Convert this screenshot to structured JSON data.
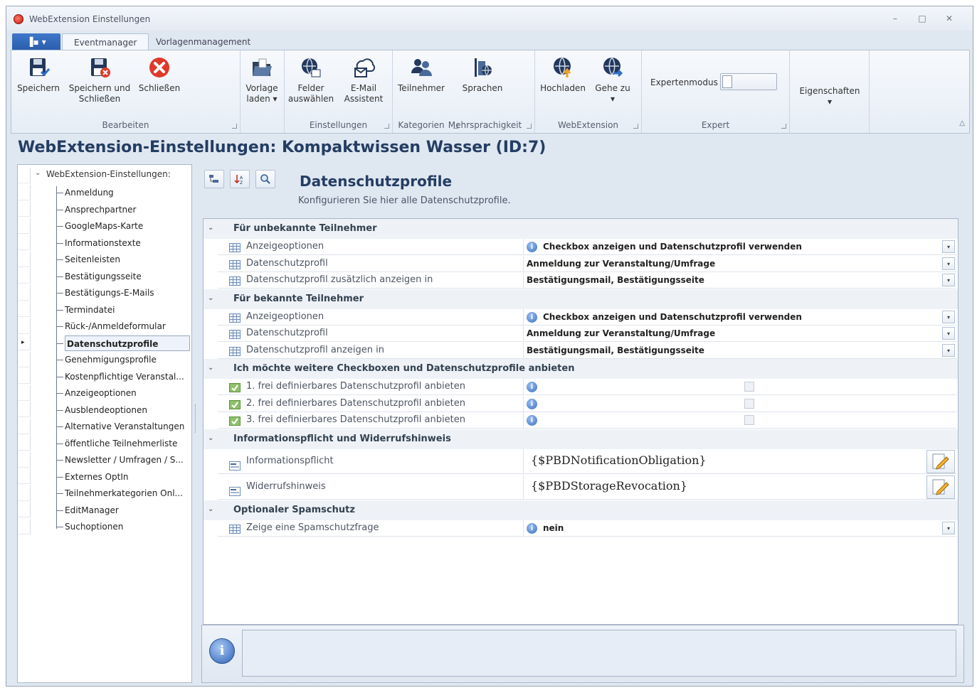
{
  "window": {
    "title": "WebExtension Einstellungen",
    "controls": [
      "–",
      "□",
      "✕"
    ]
  },
  "ribbon_tabs": {
    "menu_label": "▐▪ ▾",
    "tabs": [
      "Eventmanager",
      "Vorlagenmanagement"
    ]
  },
  "ribbon": {
    "groups": [
      {
        "label": "Bearbeiten",
        "buttons": [
          {
            "l1": "Speichern",
            "l2": ""
          },
          {
            "l1": "Speichern und",
            "l2": "Schließen"
          },
          {
            "l1": "Schließen",
            "l2": ""
          }
        ]
      },
      {
        "label": "",
        "buttons": [
          {
            "l1": "Vorlage",
            "l2": "laden ▾"
          }
        ]
      },
      {
        "label": "Einstellungen",
        "buttons": [
          {
            "l1": "Felder",
            "l2": "auswählen"
          },
          {
            "l1": "E-Mail",
            "l2": "Assistent"
          }
        ]
      },
      {
        "label": "Kategorien",
        "buttons": [
          {
            "l1": "Teilnehmer",
            "l2": ""
          }
        ]
      },
      {
        "label": "Mehrsprachigkeit",
        "buttons": [
          {
            "l1": "Sprachen",
            "l2": ""
          }
        ]
      },
      {
        "label": "WebExtension",
        "buttons": [
          {
            "l1": "Hochladen",
            "l2": ""
          },
          {
            "l1": "Gehe zu",
            "l2": "▾"
          }
        ]
      },
      {
        "label": "Expert",
        "expert_label": "Expertenmodus"
      },
      {
        "label": "",
        "buttons": [
          {
            "l1": "Eigenschaften",
            "l2": "▾"
          }
        ]
      }
    ],
    "collapse_glyph": "△"
  },
  "page_title": "WebExtension-Einstellungen: Kompaktwissen Wasser (ID:7)",
  "tree": {
    "expander": "⌄",
    "root": "WebExtension-Einstellungen:",
    "marker": "▸",
    "selected_index": 9,
    "items": [
      "Anmeldung",
      "Ansprechpartner",
      "GoogleMaps-Karte",
      "Informationstexte",
      "Seitenleisten",
      "Bestätigungsseite",
      "Bestätigungs-E-Mails",
      "Termindatei",
      "Rück-/Anmeldeformular",
      "Datenschutzprofile",
      "Genehmigungsprofile",
      "Kostenpflichtige Veranstal...",
      "Anzeigeoptionen",
      "Ausblendeoptionen",
      "Alternative Veranstaltungen",
      "öffentliche Teilnehmerliste",
      "Newsletter / Umfragen / S...",
      "Externes OptIn",
      "Teilnehmerkategorien Onl...",
      "EditManager",
      "Suchoptionen"
    ]
  },
  "main": {
    "heading": "Datenschutzprofile",
    "description": "Konfigurieren Sie hier alle Datenschutzprofile.",
    "chevron": "⌄",
    "dropdown_glyph": "▾",
    "info_glyph": "i",
    "categories": [
      {
        "label": "Für unbekannte Teilnehmer",
        "rows": [
          {
            "name": "Anzeigeoptionen",
            "value": "Checkbox anzeigen und Datenschutzprofil verwenden"
          },
          {
            "name": "Datenschutzprofil",
            "value": "Anmeldung zur Veranstaltung/Umfrage"
          },
          {
            "name": "Datenschutzprofil zusätzlich anzeigen in",
            "value": "Bestätigungsmail, Bestätigungsseite"
          }
        ]
      },
      {
        "label": "Für bekannte Teilnehmer",
        "rows": [
          {
            "name": "Anzeigeoptionen",
            "value": "Checkbox anzeigen und Datenschutzprofil verwenden"
          },
          {
            "name": "Datenschutzprofil",
            "value": "Anmeldung zur Veranstaltung/Umfrage"
          },
          {
            "name": "Datenschutzprofil anzeigen in",
            "value": "Bestätigungsmail, Bestätigungsseite"
          }
        ]
      },
      {
        "label": "Ich möchte weitere Checkboxen und Datenschutzprofile anbieten",
        "rows": [
          {
            "name": "1. frei definierbares Datenschutzprofil anbieten",
            "value": ""
          },
          {
            "name": "2. frei definierbares Datenschutzprofil anbieten",
            "value": ""
          },
          {
            "name": "3. frei definierbares Datenschutzprofil anbieten",
            "value": ""
          }
        ]
      },
      {
        "label": "Informationspflicht und Widerrufshinweis",
        "rows": [
          {
            "name": "Informationspflicht",
            "value": "{$PBDNotificationObligation}"
          },
          {
            "name": "Widerrufshinweis",
            "value": "{$PBDStorageRevocation}"
          }
        ]
      },
      {
        "label": "Optionaler Spamschutz",
        "rows": [
          {
            "name": "Zeige eine Spamschutzfrage",
            "value": "nein"
          }
        ]
      }
    ]
  },
  "status": {
    "info_glyph": "i"
  },
  "colors": {
    "accent": "#2a5dac",
    "title_text": "#243d62",
    "close_icon": "#e0392b"
  }
}
